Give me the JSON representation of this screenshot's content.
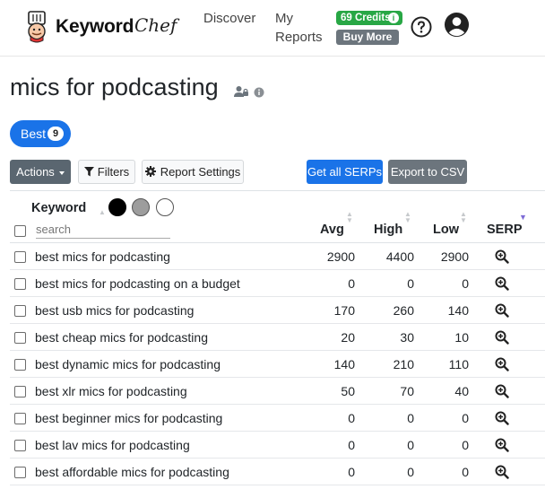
{
  "brand": {
    "name": "Keyword",
    "script": "Chef"
  },
  "nav": {
    "discover": "Discover",
    "reports_line1": "My",
    "reports_line2": "Reports"
  },
  "credits": {
    "label": "69 Credits",
    "info": "i",
    "buy_more": "Buy More"
  },
  "page": {
    "title": "mics for podcasting"
  },
  "tabs": {
    "best_label": "Best",
    "best_count": "9"
  },
  "toolbar": {
    "actions": "Actions",
    "filters": "Filters",
    "report_settings": "Report Settings",
    "get_serps": "Get all SERPs",
    "export_csv": "Export to CSV"
  },
  "table": {
    "headers": {
      "keyword": "Keyword",
      "avg": "Avg",
      "high": "High",
      "low": "Low",
      "serp": "SERP"
    },
    "search_placeholder": "search",
    "rows": [
      {
        "keyword": "best mics for podcasting",
        "avg": "2900",
        "high": "4400",
        "low": "2900"
      },
      {
        "keyword": "best mics for podcasting on a budget",
        "avg": "0",
        "high": "0",
        "low": "0"
      },
      {
        "keyword": "best usb mics for podcasting",
        "avg": "170",
        "high": "260",
        "low": "140"
      },
      {
        "keyword": "best cheap mics for podcasting",
        "avg": "20",
        "high": "30",
        "low": "10"
      },
      {
        "keyword": "best dynamic mics for podcasting",
        "avg": "140",
        "high": "210",
        "low": "110"
      },
      {
        "keyword": "best xlr mics for podcasting",
        "avg": "50",
        "high": "70",
        "low": "40"
      },
      {
        "keyword": "best beginner mics for podcasting",
        "avg": "0",
        "high": "0",
        "low": "0"
      },
      {
        "keyword": "best lav mics for podcasting",
        "avg": "0",
        "high": "0",
        "low": "0"
      },
      {
        "keyword": "best affordable mics for podcasting",
        "avg": "0",
        "high": "0",
        "low": "0"
      }
    ]
  },
  "colors": {
    "primary": "#1a73e8",
    "success": "#28a745",
    "secondary": "#6c757d",
    "dark_button": "#5a6670"
  }
}
